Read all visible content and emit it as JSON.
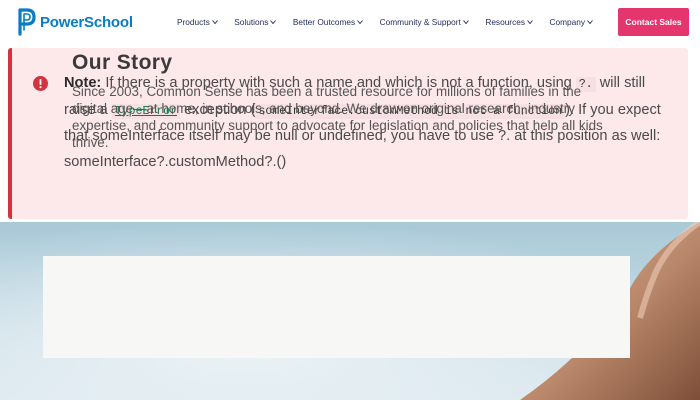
{
  "header": {
    "brand": "PowerSchool",
    "nav": [
      {
        "label": "Products",
        "icon": "chevron-down-icon"
      },
      {
        "label": "Solutions",
        "icon": "chevron-down-icon"
      },
      {
        "label": "Better Outcomes",
        "icon": "chevron-down-icon"
      },
      {
        "label": "Community & Support",
        "icon": "chevron-down-icon"
      },
      {
        "label": "Resources",
        "icon": "chevron-down-icon"
      },
      {
        "label": "Company",
        "icon": "chevron-down-icon"
      }
    ],
    "cta_label": "Contact Sales"
  },
  "note": {
    "icon": "warning-icon",
    "label": "Note:",
    "text_1": "If there is a property with such a name and which is not a function, using",
    "code_1": "?.",
    "text_2": "will still raise a",
    "code_link": "TypeError",
    "text_3": "exception (",
    "code_2": "someInterface.customMethod is not a function",
    "text_4": "). If you expect that someInterface itself may be null or undefined, you have to use ?. at this position as well: someInterface?.customMethod?.()"
  },
  "story": {
    "title": "Our Story",
    "body": "Since 2003, Common Sense has been a trusted resource for millions of families in the digital age—at home, in schools, and beyond. We draw on original research, industry expertise, and community support to advocate for legislation and policies that help all kids thrive."
  },
  "colors": {
    "brand_blue": "#0a7cc1",
    "nav_text": "#1f2a5c",
    "cta": "#e4366c",
    "note_bg": "#fde8ea",
    "note_border": "#d3333e"
  }
}
